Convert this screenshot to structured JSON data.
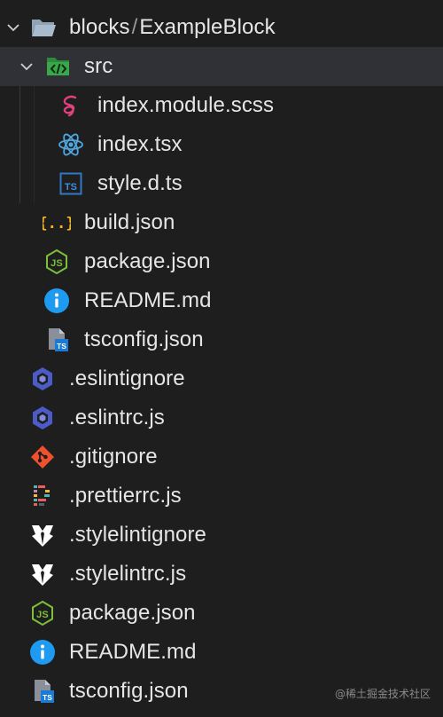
{
  "root": {
    "parent": "blocks",
    "separator": "/",
    "name": "ExampleBlock",
    "expanded": true
  },
  "src_folder": {
    "name": "src",
    "expanded": true
  },
  "src_files": [
    {
      "name": "index.module.scss",
      "icon": "sass-icon"
    },
    {
      "name": "index.tsx",
      "icon": "react-icon"
    },
    {
      "name": "style.d.ts",
      "icon": "typescript-icon"
    }
  ],
  "block_files": [
    {
      "name": "build.json",
      "icon": "json-icon"
    },
    {
      "name": "package.json",
      "icon": "nodejs-icon"
    },
    {
      "name": "README.md",
      "icon": "info-icon"
    },
    {
      "name": "tsconfig.json",
      "icon": "tsconfig-icon"
    }
  ],
  "root_files": [
    {
      "name": ".eslintignore",
      "icon": "eslint-icon"
    },
    {
      "name": ".eslintrc.js",
      "icon": "eslint-icon"
    },
    {
      "name": ".gitignore",
      "icon": "git-icon"
    },
    {
      "name": ".prettierrc.js",
      "icon": "prettier-icon"
    },
    {
      "name": ".stylelintignore",
      "icon": "stylelint-icon"
    },
    {
      "name": ".stylelintrc.js",
      "icon": "stylelint-icon"
    },
    {
      "name": "package.json",
      "icon": "nodejs-icon"
    },
    {
      "name": "README.md",
      "icon": "info-icon"
    },
    {
      "name": "tsconfig.json",
      "icon": "tsconfig-icon"
    }
  ],
  "watermark": "@稀土掘金技术社区",
  "colors": {
    "background": "#1e1e1e",
    "selected_row": "#2f3136",
    "text": "#e6e6e6",
    "folder_src": "#3aa74a",
    "sass": "#e0407b",
    "react": "#4fa8e0",
    "typescript": "#3178c6",
    "json": "#f0b429",
    "nodejs": "#7bbf3a",
    "info": "#1e9bf0",
    "eslint": "#4b5bc8",
    "git": "#f0512c",
    "stylelint": "#ffffff"
  }
}
